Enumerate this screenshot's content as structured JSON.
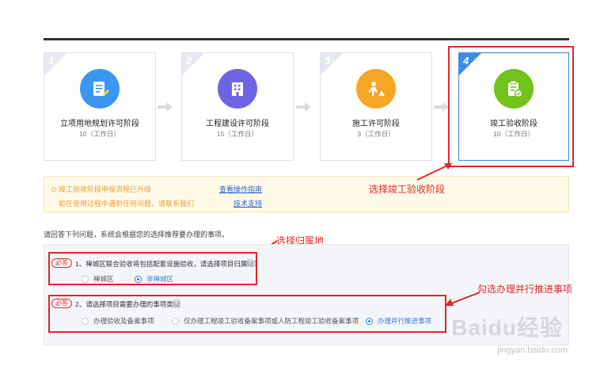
{
  "stages": [
    {
      "num": "1",
      "title": "立项用地规划许可阶段",
      "days": "10（工作日）",
      "color": "#3a97f0",
      "icon": "document-edit-icon"
    },
    {
      "num": "2",
      "title": "工程建设许可阶段",
      "days": "15（工作日）",
      "color": "#6e64e6",
      "icon": "building-icon"
    },
    {
      "num": "3",
      "title": "施工许可阶段",
      "days": "3（工作日）",
      "color": "#f5a623",
      "icon": "construction-worker-icon"
    },
    {
      "num": "4",
      "title": "竣工验收阶段",
      "days": "10（工作日）",
      "color": "#71c21c",
      "icon": "clipboard-check-icon"
    }
  ],
  "notice": {
    "line1": "⊙ 竣工验收阶段申报流程已升级",
    "line2": "如在使用过程中遇到任何问题，请联系我们",
    "link1": "查看操作指南",
    "link2": "技术支持"
  },
  "intro": "请回答下列问题，系统会根据您的选择推荐要办理的事项。",
  "questions": [
    {
      "badge": "必答",
      "text": "1、禅城区联合验收将包括配套设施验收，请选择项目归属地？",
      "options": [
        "禅城区",
        "非禅城区"
      ]
    },
    {
      "badge": "必答",
      "text": "2、请选择项目需要办理的事项类型",
      "options": [
        "办理验收及备案事项",
        "仅办理工程竣工验收备案事项或人防工程竣工验收备案事项",
        "办理并行推进事项"
      ]
    }
  ],
  "annotations": {
    "stage": "选择竣工验收阶段",
    "region": "选择归属地",
    "parallel": "勾选办理并行推进事项"
  },
  "watermark": {
    "main": "Baidu经验",
    "sub": "jingyan.baidu.com"
  }
}
